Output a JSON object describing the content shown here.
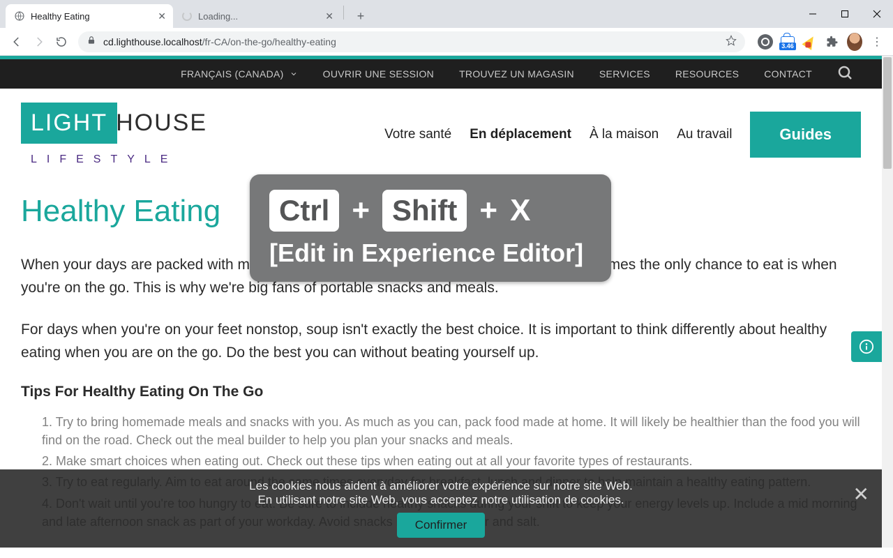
{
  "browser": {
    "tabs": [
      {
        "title": "Healthy Eating",
        "state": "active"
      },
      {
        "title": "Loading...",
        "state": "loading"
      }
    ],
    "url_host": "cd.lighthouse.localhost",
    "url_path": "/fr-CA/on-the-go/healthy-eating",
    "lighthouse_badge": "3.46"
  },
  "topbar": {
    "language": "FRANÇAIS (CANADA)",
    "items": [
      "OUVRIR UNE SESSION",
      "TROUVEZ UN MAGASIN",
      "SERVICES",
      "RESOURCES",
      "CONTACT"
    ]
  },
  "brand": {
    "left": "LIGHT",
    "right": "HOUSE",
    "sub": "LIFESTYLE"
  },
  "mainnav": {
    "items": [
      "Votre santé",
      "En déplacement",
      "À la maison",
      "Au travail"
    ],
    "active_index": 1,
    "guides": "Guides"
  },
  "page": {
    "title": "Healthy Eating",
    "para1": "When your days are packed with meetings, appointments, errands, and social time, sometimes the only chance to eat is when you're on the go. This is why we're big fans of portable snacks and meals.",
    "para2": "For days when you're on your feet nonstop, soup isn't exactly the best choice. It is important to think differently about healthy eating when you are on the go. Do the best you can without beating yourself up.",
    "tips_header": "Tips For Healthy Eating On The Go",
    "tips": [
      "1. Try to bring homemade meals and snacks with you. As much as you can, pack food made at home. It will likely be healthier than the food you will find on the road. Check out the meal builder to help you plan your snacks and meals.",
      "2. Make smart choices when eating out. Check out these tips when eating out at all your favorite types of restaurants.",
      "3. Try to eat regularly. Aim to eat around the same times everyday for breakfast, lunch and dinner to help maintain a healthy eating pattern.",
      "4. Don't wait until you're too hungry to eat. Be sure to include healthy snacks during your shift to keep your energy levels up. Include a mid morning and late afternoon snack as part of your workday. Avoid snacks high in fat, sugar and salt."
    ]
  },
  "overlay": {
    "keys": [
      "Ctrl",
      "Shift"
    ],
    "final_key": "X",
    "plus": "+",
    "caption": "[Edit in Experience Editor]"
  },
  "cookies": {
    "line1": "Les cookies nous aident à améliorer votre expérience sur notre site Web.",
    "line2": "En utilisant notre site Web, vous acceptez notre utilisation de cookies.",
    "confirm": "Confirmer"
  }
}
